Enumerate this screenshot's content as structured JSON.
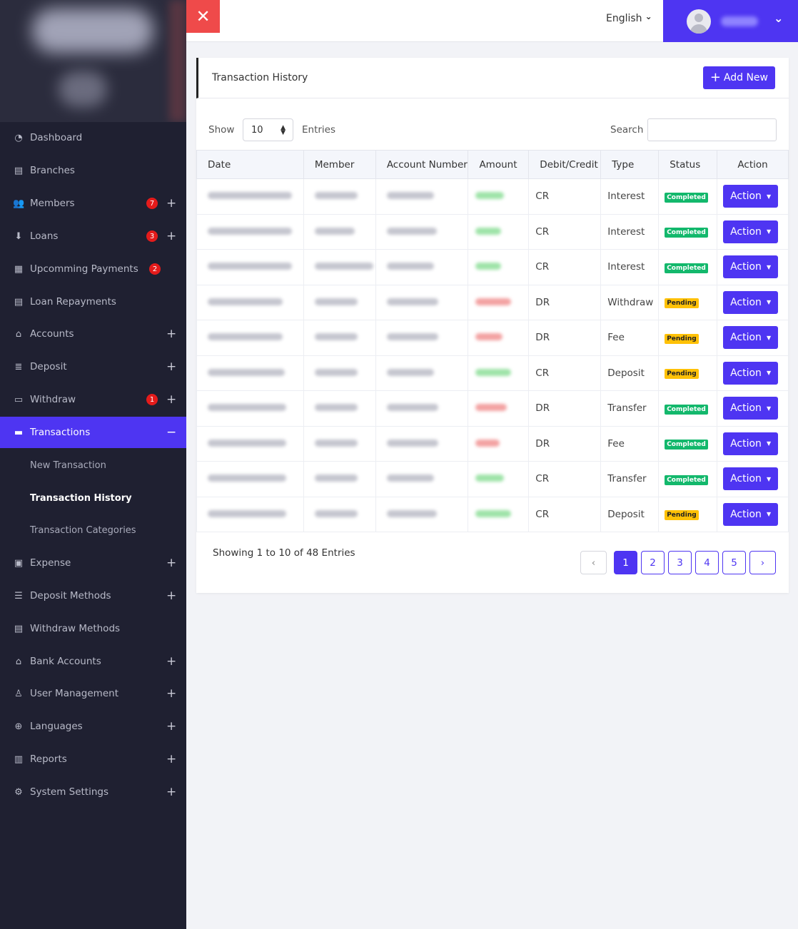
{
  "sidebar": {
    "items": [
      {
        "label": "Dashboard",
        "icon": "dashboard-icon",
        "glyph": "◔",
        "badge": "",
        "plus": ""
      },
      {
        "label": "Branches",
        "icon": "building-icon",
        "glyph": "▤",
        "badge": "",
        "plus": ""
      },
      {
        "label": "Members",
        "icon": "users-icon",
        "glyph": "👥",
        "badge": "7",
        "plus": "+"
      },
      {
        "label": "Loans",
        "icon": "hand-coin-icon",
        "glyph": "⬇",
        "badge": "3",
        "plus": "+"
      },
      {
        "label": "Upcomming Payments",
        "icon": "calendar-icon",
        "glyph": "▦",
        "badge": "2",
        "plus": ""
      },
      {
        "label": "Loan Repayments",
        "icon": "receipt-icon",
        "glyph": "▤",
        "badge": "",
        "plus": ""
      },
      {
        "label": "Accounts",
        "icon": "bank-icon",
        "glyph": "⌂",
        "badge": "",
        "plus": "+"
      },
      {
        "label": "Deposit",
        "icon": "coins-icon",
        "glyph": "≣",
        "badge": "",
        "plus": "+"
      },
      {
        "label": "Withdraw",
        "icon": "wallet-icon",
        "glyph": "▭",
        "badge": "1",
        "plus": "+"
      },
      {
        "label": "Transactions",
        "icon": "folder-icon",
        "glyph": "▬",
        "badge": "",
        "plus": "−"
      },
      {
        "label": "Expense",
        "icon": "money-icon",
        "glyph": "▣",
        "badge": "",
        "plus": "+"
      },
      {
        "label": "Deposit Methods",
        "icon": "list-icon",
        "glyph": "☰",
        "badge": "",
        "plus": "+"
      },
      {
        "label": "Withdraw Methods",
        "icon": "receipt-icon",
        "glyph": "▤",
        "badge": "",
        "plus": ""
      },
      {
        "label": "Bank Accounts",
        "icon": "bank-icon",
        "glyph": "⌂",
        "badge": "",
        "plus": "+"
      },
      {
        "label": "User Management",
        "icon": "user-icon",
        "glyph": "♙",
        "badge": "",
        "plus": "+"
      },
      {
        "label": "Languages",
        "icon": "globe-icon",
        "glyph": "⊕",
        "badge": "",
        "plus": "+"
      },
      {
        "label": "Reports",
        "icon": "bar-chart-icon",
        "glyph": "▥",
        "badge": "",
        "plus": "+"
      },
      {
        "label": "System Settings",
        "icon": "gear-icon",
        "glyph": "⚙",
        "badge": "",
        "plus": "+"
      }
    ],
    "subitems": [
      "New Transaction",
      "Transaction History",
      "Transaction Categories"
    ]
  },
  "topbar": {
    "close_glyph": "✕",
    "language": "English",
    "language_caret": "⌄",
    "user_caret": "⌄"
  },
  "card": {
    "title": "Transaction History",
    "add_button": "Add New",
    "add_glyph": "+",
    "show_label": "Show",
    "entries_value": "10",
    "entries_label": "Entries",
    "search_label": "Search",
    "search_value": ""
  },
  "table": {
    "headers": [
      "Date",
      "Member",
      "Account Number",
      "Amount",
      "Debit/Credit",
      "Type",
      "Status",
      "Action"
    ],
    "rows": [
      {
        "dc": "CR",
        "type": "Interest",
        "status": "Completed",
        "action": "Action"
      },
      {
        "dc": "CR",
        "type": "Interest",
        "status": "Completed",
        "action": "Action"
      },
      {
        "dc": "CR",
        "type": "Interest",
        "status": "Completed",
        "action": "Action"
      },
      {
        "dc": "DR",
        "type": "Withdraw",
        "status": "Pending",
        "action": "Action"
      },
      {
        "dc": "DR",
        "type": "Fee",
        "status": "Pending",
        "action": "Action"
      },
      {
        "dc": "CR",
        "type": "Deposit",
        "status": "Pending",
        "action": "Action"
      },
      {
        "dc": "DR",
        "type": "Transfer",
        "status": "Completed",
        "action": "Action"
      },
      {
        "dc": "DR",
        "type": "Fee",
        "status": "Completed",
        "action": "Action"
      },
      {
        "dc": "CR",
        "type": "Transfer",
        "status": "Completed",
        "action": "Action"
      },
      {
        "dc": "CR",
        "type": "Deposit",
        "status": "Pending",
        "action": "Action"
      }
    ]
  },
  "footer": {
    "showing": "Showing 1 to 10 of 48 Entries",
    "pages": [
      "1",
      "2",
      "3",
      "4",
      "5"
    ],
    "prev": "‹",
    "next": "›"
  },
  "colors": {
    "accent": "#4e35f2",
    "sidebar_bg": "#1f2031",
    "close_red": "#ef4a4a",
    "completed": "#13b86c",
    "pending": "#ffc107",
    "badge_red": "#e41b1b"
  }
}
